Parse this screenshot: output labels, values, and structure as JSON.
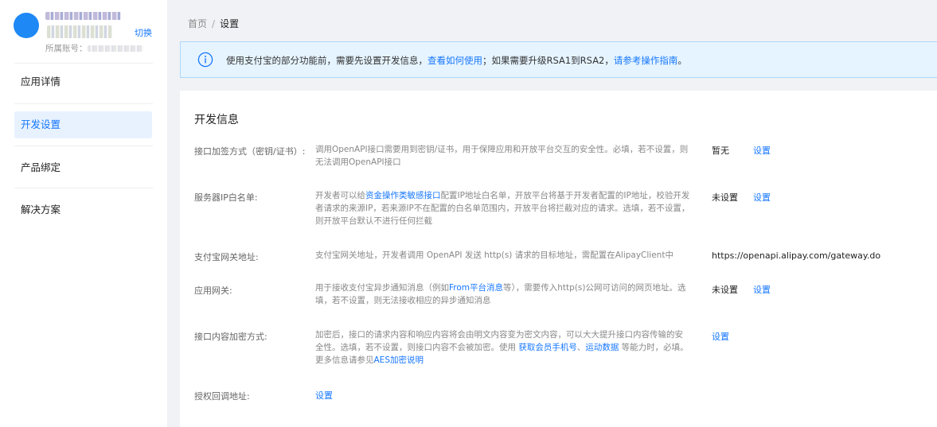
{
  "sidebar": {
    "switch_label": "切换",
    "account_label": "所属账号：",
    "items": [
      {
        "label": "应用详情",
        "active": false
      },
      {
        "label": "开发设置",
        "active": true
      },
      {
        "label": "产品绑定",
        "active": false
      },
      {
        "label": "解决方案",
        "active": false
      }
    ]
  },
  "breadcrumb": {
    "home": "首页",
    "separator": "/",
    "current": "设置"
  },
  "alert": {
    "icon": "info-circle-icon",
    "text_1": "使用支付宝的部分功能前，需要先设置开发信息，",
    "link_1": "查看如何使用",
    "text_2": "；如果需要升级RSA1到RSA2，",
    "link_2": "请参考操作指南",
    "text_3": "。"
  },
  "section": {
    "title": "开发信息",
    "rows": [
      {
        "label": "接口加签方式（密钥/证书）:",
        "desc_parts": [
          "调用OpenAPI接口需要用到密钥/证书，用于保障应用和开放平台交互的安全性。必填，若不设置，则无法调用OpenAPI接口"
        ],
        "status": "暂无",
        "action": "设置"
      },
      {
        "label": "服务器IP白名单:",
        "desc_parts": [
          "开发者可以给",
          "资金操作类敏感接口",
          "配置IP地址白名单，开放平台将基于开发者配置的IP地址，校验开发者请求的来源IP，若来源IP不在配置的白名单范围内，开放平台将拦截对应的请求。选填，若不设置，则开放平台默认不进行任何拦截"
        ],
        "status": "未设置",
        "action": "设置"
      },
      {
        "label": "支付宝网关地址:",
        "desc_parts": [
          "支付宝网关地址，开发者调用 OpenAPI 发送 http(s) 请求的目标地址，需配置在AlipayClient中"
        ],
        "status": "https://openapi.alipay.com/gateway.do"
      },
      {
        "label": "应用网关:",
        "desc_parts": [
          "用于接收支付宝异步通知消息（例如",
          "From平台消息",
          "等），需要传入http(s)公网可访问的网页地址。选填，若不设置，则无法接收相应的异步通知消息"
        ],
        "status": "未设置",
        "action": "设置"
      },
      {
        "label": "接口内容加密方式:",
        "desc_parts": [
          "加密后，接口的请求内容和响应内容将会由明文内容变为密文内容，可以大大提升接口内容传输的安全性。选填，若不设置，则接口内容不会被加密。使用 ",
          "获取会员手机号",
          "、",
          "运动数据",
          " 等能力时，必填。更多信息请参见",
          "AES加密说明"
        ],
        "action": "设置"
      },
      {
        "label": "授权回调地址:",
        "action": "设置"
      }
    ]
  },
  "colors": {
    "accent": "#1677ff",
    "alert_bg": "#e6f4ff",
    "nav_active_bg": "#e8f2ff",
    "avatar": "#1e88f5"
  }
}
